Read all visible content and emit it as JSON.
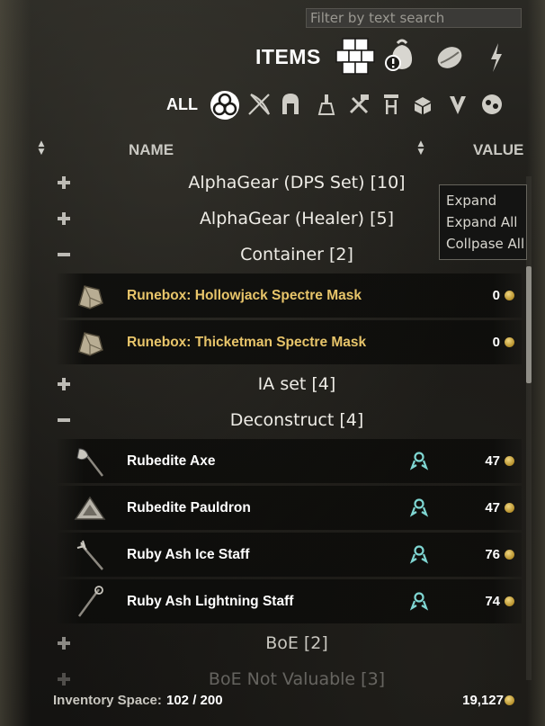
{
  "search": {
    "placeholder": "Filter by text search"
  },
  "header": {
    "title": "ITEMS",
    "category_icons": [
      "items-cubes-icon",
      "quest-bag-icon",
      "junk-icon",
      "quickslot-icon"
    ]
  },
  "filters": {
    "all_label": "ALL",
    "icons": [
      "all-triquetra-icon",
      "weapons-icon",
      "armor-icon",
      "consumables-icon",
      "materials-icon",
      "furnishing-icon",
      "misc-icon",
      "junk-icon",
      "companion-icon"
    ]
  },
  "columns": {
    "name": "NAME",
    "value": "VALUE"
  },
  "groups": [
    {
      "label": "AlphaGear (DPS Set) [10]",
      "expanded": false
    },
    {
      "label": "AlphaGear (Healer) [5]",
      "expanded": false
    },
    {
      "label": "Container [2]",
      "expanded": true,
      "items": [
        {
          "name": "Runebox: Hollowjack Spectre Mask",
          "value": "0",
          "icon": "runebox-icon",
          "color": "#e8c56a"
        },
        {
          "name": "Runebox: Thicketman Spectre Mask",
          "value": "0",
          "icon": "runebox-icon",
          "color": "#e8c56a"
        }
      ]
    },
    {
      "label": "IA set [4]",
      "expanded": false
    },
    {
      "label": "Deconstruct [4]",
      "expanded": true,
      "items": [
        {
          "name": "Rubedite Axe",
          "value": "47",
          "icon": "axe-icon",
          "color": "#ffffff"
        },
        {
          "name": "Rubedite Pauldron",
          "value": "47",
          "icon": "pauldron-icon",
          "color": "#ffffff"
        },
        {
          "name": "Ruby Ash Ice Staff",
          "value": "76",
          "icon": "ice-staff-icon",
          "color": "#ffffff"
        },
        {
          "name": "Ruby Ash Lightning Staff",
          "value": "74",
          "icon": "lightning-staff-icon",
          "color": "#ffffff"
        }
      ]
    },
    {
      "label": "BoE [2]",
      "expanded": false
    },
    {
      "label": "BoE Not Valuable [3]",
      "expanded": false
    }
  ],
  "context_menu": {
    "items": [
      "Expand",
      "Expand All",
      "Collpase All"
    ]
  },
  "footer": {
    "space_label": "Inventory Space:",
    "space_value": "102 / 200",
    "gold": "19,127"
  },
  "colors": {
    "accent_gold": "#e8c56a",
    "research_teal": "#7fd6d2",
    "coin": "#d2b04a"
  }
}
